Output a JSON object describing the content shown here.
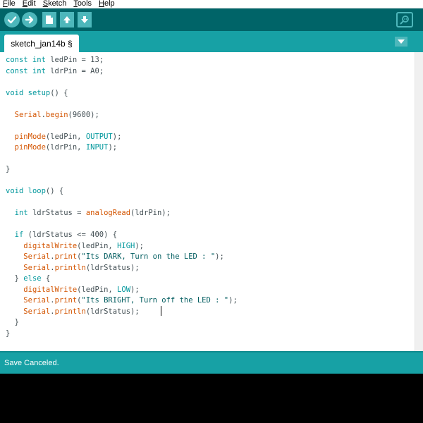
{
  "menu": [
    {
      "label": "File"
    },
    {
      "label": "Edit"
    },
    {
      "label": "Sketch"
    },
    {
      "label": "Tools"
    },
    {
      "label": "Help"
    }
  ],
  "toolbar": {
    "buttons": [
      {
        "icon": "verify-icon"
      },
      {
        "icon": "upload-icon"
      },
      {
        "icon": "new-icon"
      },
      {
        "icon": "open-icon"
      },
      {
        "icon": "save-icon"
      }
    ],
    "serial_monitor_icon": "serial-monitor-icon"
  },
  "tab": {
    "label": "sketch_jan14b §"
  },
  "code_lines": [
    [
      {
        "t": "const int",
        "c": "kw"
      },
      {
        "t": " ledPin = 13;"
      }
    ],
    [
      {
        "t": "const int",
        "c": "kw"
      },
      {
        "t": " ldrPin = A0;"
      }
    ],
    [],
    [
      {
        "t": "void",
        "c": "kw"
      },
      {
        "t": " "
      },
      {
        "t": "setup",
        "c": "kw"
      },
      {
        "t": "() {"
      }
    ],
    [],
    [
      {
        "t": "  "
      },
      {
        "t": "Serial",
        "c": "fn"
      },
      {
        "t": "."
      },
      {
        "t": "begin",
        "c": "fn"
      },
      {
        "t": "(9600);"
      }
    ],
    [],
    [
      {
        "t": "  "
      },
      {
        "t": "pinMode",
        "c": "fn"
      },
      {
        "t": "(ledPin, "
      },
      {
        "t": "OUTPUT",
        "c": "cn"
      },
      {
        "t": ");"
      }
    ],
    [
      {
        "t": "  "
      },
      {
        "t": "pinMode",
        "c": "fn"
      },
      {
        "t": "(ldrPin, "
      },
      {
        "t": "INPUT",
        "c": "cn"
      },
      {
        "t": ");"
      }
    ],
    [],
    [
      {
        "t": "}"
      }
    ],
    [],
    [
      {
        "t": "void",
        "c": "kw"
      },
      {
        "t": " "
      },
      {
        "t": "loop",
        "c": "kw"
      },
      {
        "t": "() {"
      }
    ],
    [],
    [
      {
        "t": "  "
      },
      {
        "t": "int",
        "c": "kw"
      },
      {
        "t": " ldrStatus = "
      },
      {
        "t": "analogRead",
        "c": "fn"
      },
      {
        "t": "(ldrPin);"
      }
    ],
    [],
    [
      {
        "t": "  "
      },
      {
        "t": "if",
        "c": "kw"
      },
      {
        "t": " (ldrStatus <= 400) {"
      }
    ],
    [
      {
        "t": "    "
      },
      {
        "t": "digitalWrite",
        "c": "fn"
      },
      {
        "t": "(ledPin, "
      },
      {
        "t": "HIGH",
        "c": "cn"
      },
      {
        "t": ");"
      }
    ],
    [
      {
        "t": "    "
      },
      {
        "t": "Serial",
        "c": "fn"
      },
      {
        "t": "."
      },
      {
        "t": "print",
        "c": "fn"
      },
      {
        "t": "("
      },
      {
        "t": "\"Its DARK, Turn on the LED : \"",
        "c": "st"
      },
      {
        "t": ");"
      }
    ],
    [
      {
        "t": "    "
      },
      {
        "t": "Serial",
        "c": "fn"
      },
      {
        "t": "."
      },
      {
        "t": "println",
        "c": "fn"
      },
      {
        "t": "(ldrStatus);"
      }
    ],
    [
      {
        "t": "  } "
      },
      {
        "t": "else",
        "c": "kw"
      },
      {
        "t": " {"
      }
    ],
    [
      {
        "t": "    "
      },
      {
        "t": "digitalWrite",
        "c": "fn"
      },
      {
        "t": "(ledPin, "
      },
      {
        "t": "LOW",
        "c": "cn"
      },
      {
        "t": ");"
      }
    ],
    [
      {
        "t": "    "
      },
      {
        "t": "Serial",
        "c": "fn"
      },
      {
        "t": "."
      },
      {
        "t": "print",
        "c": "fn"
      },
      {
        "t": "("
      },
      {
        "t": "\"Its BRIGHT, Turn off the LED : \"",
        "c": "st"
      },
      {
        "t": ");"
      }
    ],
    [
      {
        "t": "    "
      },
      {
        "t": "Serial",
        "c": "fn"
      },
      {
        "t": "."
      },
      {
        "t": "println",
        "c": "fn"
      },
      {
        "t": "(ldrStatus);"
      }
    ],
    [
      {
        "t": "  }"
      }
    ],
    [
      {
        "t": "}"
      }
    ]
  ],
  "status": {
    "message": "Save Canceled."
  },
  "colors": {
    "toolbar_bg": "#006468",
    "tabbar_bg": "#17a1a5",
    "button_bg": "#4db7bb",
    "keyword": "#00979c",
    "function": "#d35400",
    "console_bg": "#000000"
  }
}
